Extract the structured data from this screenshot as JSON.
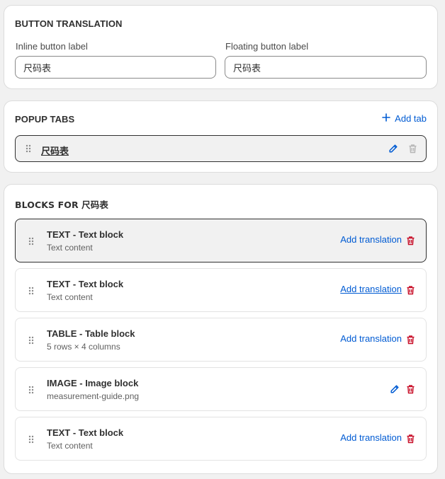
{
  "colors": {
    "accent": "#005bd3",
    "critical": "#c70a24",
    "disabled_icon": "#b5b5b5",
    "selected_row_bg": "#f1f1f1"
  },
  "button_translation": {
    "title": "BUTTON TRANSLATION",
    "inline_label": "Inline button label",
    "inline_value": "尺码表",
    "floating_label": "Floating button label",
    "floating_value": "尺码表"
  },
  "popup_tabs": {
    "title": "POPUP TABS",
    "add_tab_label": "Add tab",
    "add_tab_icon": "plus-icon",
    "tabs": [
      {
        "name": "尺码表",
        "edit_icon": "pencil-icon",
        "delete_icon": "trash-icon"
      }
    ]
  },
  "blocks": {
    "title": "BLOCKS FOR 尺码表",
    "items": [
      {
        "type": "TEXT",
        "sep": " - ",
        "name": "Text block",
        "subtitle": "Text content",
        "action": "Add translation",
        "selected": true
      },
      {
        "type": "TEXT",
        "sep": " - ",
        "name": "Text block",
        "subtitle": "Text content",
        "action": "Add translation",
        "hovered": true
      },
      {
        "type": "TABLE",
        "sep": " - ",
        "name": "Table block",
        "subtitle": "5 rows × 4 columns",
        "action": "Add translation"
      },
      {
        "type": "IMAGE",
        "sep": " - ",
        "name": "Image block",
        "subtitle": "measurement-guide.png",
        "action_icon": "pencil-icon"
      },
      {
        "type": "TEXT",
        "sep": " - ",
        "name": "Text block",
        "subtitle": "Text content",
        "action": "Add translation"
      }
    ]
  }
}
